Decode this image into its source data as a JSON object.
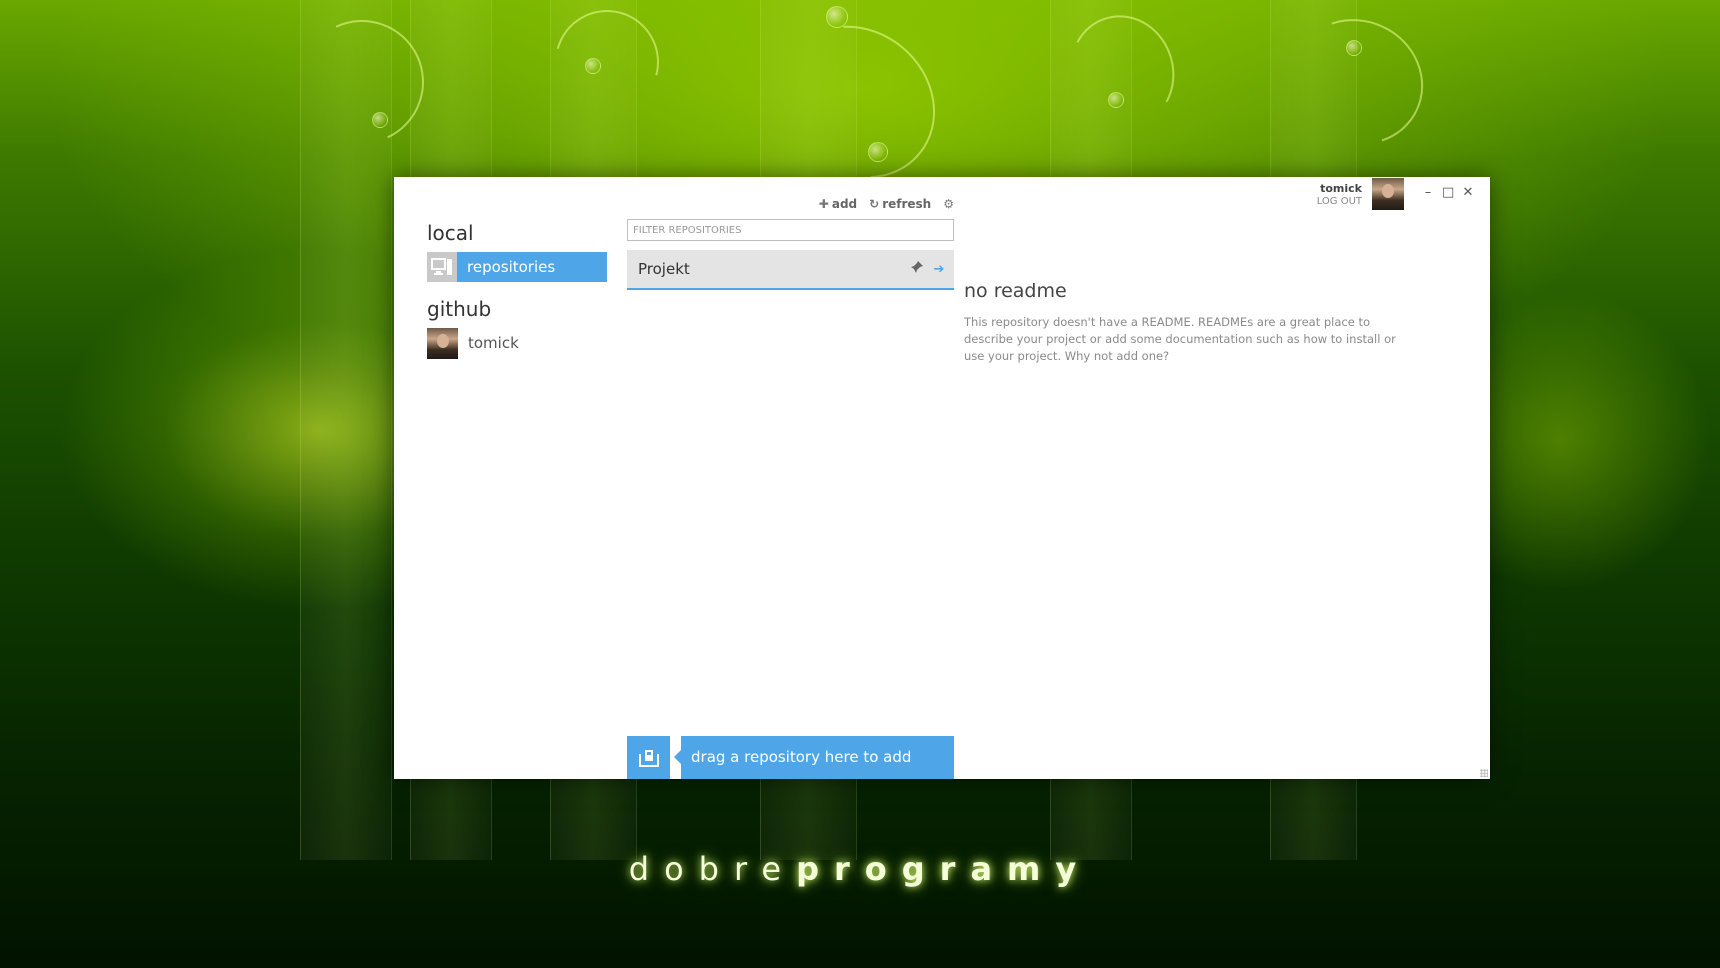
{
  "window": {
    "controls": {
      "minimize": "–",
      "maximize": "□",
      "close": "✕"
    }
  },
  "user": {
    "name": "tomick",
    "logout_label": "LOG OUT"
  },
  "sidebar": {
    "local_title": "local",
    "local_items": [
      {
        "label": "repositories",
        "icon": "computer-icon",
        "active": true
      }
    ],
    "github_title": "github",
    "github_items": [
      {
        "label": "tomick",
        "icon": "avatar"
      }
    ]
  },
  "toolbar": {
    "add_label": "add",
    "refresh_label": "refresh",
    "add_icon": "plus-icon",
    "refresh_icon": "refresh-icon",
    "settings_icon": "gear-icon"
  },
  "filter": {
    "placeholder": "FILTER REPOSITORIES",
    "value": ""
  },
  "repositories": [
    {
      "name": "Projekt",
      "actions": [
        "pin-icon",
        "arrow-right-icon"
      ]
    }
  ],
  "dropzone": {
    "label": "drag a repository here to add",
    "icon": "drop-repo-icon"
  },
  "readme": {
    "title": "no readme",
    "body": "This repository doesn't have a README. READMEs are a great place to describe your project or add some documentation such as how to install or use your project. Why not add one?"
  },
  "brand": {
    "light": "dobre",
    "bold": "programy"
  },
  "colors": {
    "accent": "#4ea6e8",
    "selected_row_bg": "#e4e4e4",
    "icon_tile": "#c9c9c9"
  }
}
